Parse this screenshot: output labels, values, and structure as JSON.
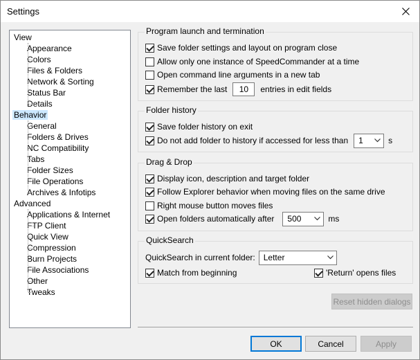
{
  "window": {
    "title": "Settings"
  },
  "tree": {
    "items": [
      {
        "label": "View",
        "level": 0
      },
      {
        "label": "Appearance",
        "level": 1
      },
      {
        "label": "Colors",
        "level": 1
      },
      {
        "label": "Files & Folders",
        "level": 1
      },
      {
        "label": "Network & Sorting",
        "level": 1
      },
      {
        "label": "Status Bar",
        "level": 1
      },
      {
        "label": "Details",
        "level": 1
      },
      {
        "label": "Behavior",
        "level": 0,
        "selected": true
      },
      {
        "label": "General",
        "level": 1
      },
      {
        "label": "Folders & Drives",
        "level": 1
      },
      {
        "label": "NC Compatibility",
        "level": 1
      },
      {
        "label": "Tabs",
        "level": 1
      },
      {
        "label": "Folder Sizes",
        "level": 1
      },
      {
        "label": "File Operations",
        "level": 1
      },
      {
        "label": "Archives & Infotips",
        "level": 1
      },
      {
        "label": "Advanced",
        "level": 0
      },
      {
        "label": "Applications & Internet",
        "level": 1
      },
      {
        "label": "FTP Client",
        "level": 1
      },
      {
        "label": "Quick View",
        "level": 1
      },
      {
        "label": "Compression",
        "level": 1
      },
      {
        "label": "Burn Projects",
        "level": 1
      },
      {
        "label": "File Associations",
        "level": 1
      },
      {
        "label": "Other",
        "level": 1
      },
      {
        "label": "Tweaks",
        "level": 1
      }
    ]
  },
  "launch": {
    "title": "Program launch and termination",
    "save_layout": {
      "label": "Save folder settings and layout on program close",
      "checked": true
    },
    "one_instance": {
      "label": "Allow only one instance of SpeedCommander at a time",
      "checked": false
    },
    "open_args": {
      "label": "Open command line arguments in a new tab",
      "checked": false
    },
    "remember": {
      "label_before": "Remember the last",
      "value": "10",
      "label_after": "entries in edit fields",
      "checked": true
    }
  },
  "history": {
    "title": "Folder history",
    "save_exit": {
      "label": "Save folder history on exit",
      "checked": true
    },
    "dont_add": {
      "label": "Do not add folder to history if accessed for less than",
      "value": "1",
      "unit": "s",
      "checked": true
    }
  },
  "dragdrop": {
    "title": "Drag & Drop",
    "display_icon": {
      "label": "Display icon, description and target folder",
      "checked": true
    },
    "follow_explorer": {
      "label": "Follow Explorer behavior when moving files on the same drive",
      "checked": true
    },
    "right_button": {
      "label": "Right mouse button moves files",
      "checked": false
    },
    "open_auto": {
      "label": "Open folders automatically after",
      "value": "500",
      "unit": "ms",
      "checked": true
    }
  },
  "quicksearch": {
    "title": "QuickSearch",
    "mode_label": "QuickSearch in current folder:",
    "mode_value": "Letter",
    "match_beginning": {
      "label": "Match from beginning",
      "checked": true
    },
    "return_opens": {
      "label": "'Return' opens files",
      "checked": true
    }
  },
  "buttons": {
    "reset": "Reset hidden dialogs",
    "ok": "OK",
    "cancel": "Cancel",
    "apply": "Apply"
  }
}
